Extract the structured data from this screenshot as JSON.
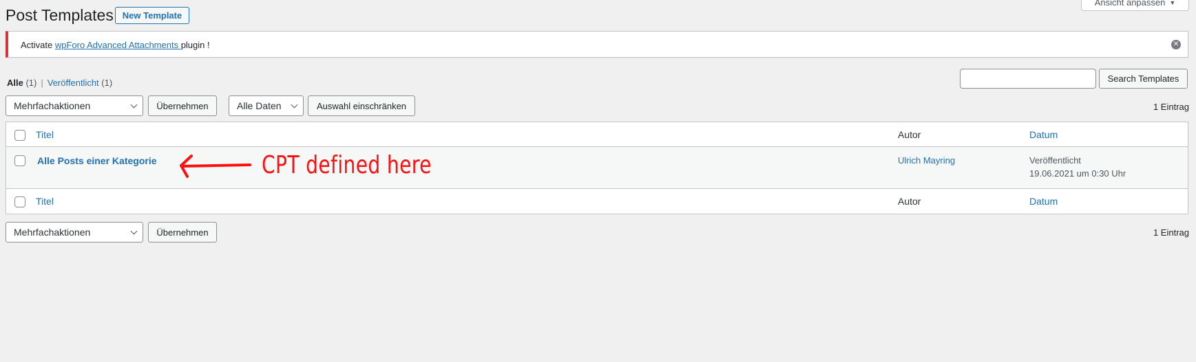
{
  "header": {
    "title": "Post Templates",
    "new_button": "New Template",
    "screen_options": "Ansicht anpassen"
  },
  "notice": {
    "prefix": "Activate ",
    "link": "wpForo Advanced Attachments ",
    "suffix": "plugin !"
  },
  "views": {
    "all_label": "Alle",
    "all_count": "(1)",
    "separator": "|",
    "published_label": "Veröffentlicht",
    "published_count": "(1)"
  },
  "search": {
    "value": "",
    "button": "Search Templates"
  },
  "tablenav_top": {
    "bulk_action": "Mehrfachaktionen",
    "apply": "Übernehmen",
    "date_filter": "Alle Daten",
    "filter_button": "Auswahl einschränken",
    "item_count": "1 Eintrag"
  },
  "table": {
    "columns": {
      "title": "Titel",
      "author": "Autor",
      "date": "Datum"
    },
    "rows": [
      {
        "title": "Alle Posts einer Kategorie",
        "author": "Ulrich Mayring",
        "status": "Veröffentlicht",
        "datetime": "19.06.2021 um 0:30 Uhr"
      }
    ]
  },
  "tablenav_bottom": {
    "bulk_action": "Mehrfachaktionen",
    "apply": "Übernehmen",
    "item_count": "1 Eintrag"
  },
  "annotation": {
    "text": "CPT defined here",
    "color": "#ff1010"
  },
  "colors": {
    "link": "#2271b1",
    "notice_error": "#d63638",
    "background": "#f0f0f1"
  },
  "icons": {
    "dismiss": "close-circle-icon",
    "dropdown": "chevron-down-icon",
    "arrow": "arrow-left-icon"
  }
}
